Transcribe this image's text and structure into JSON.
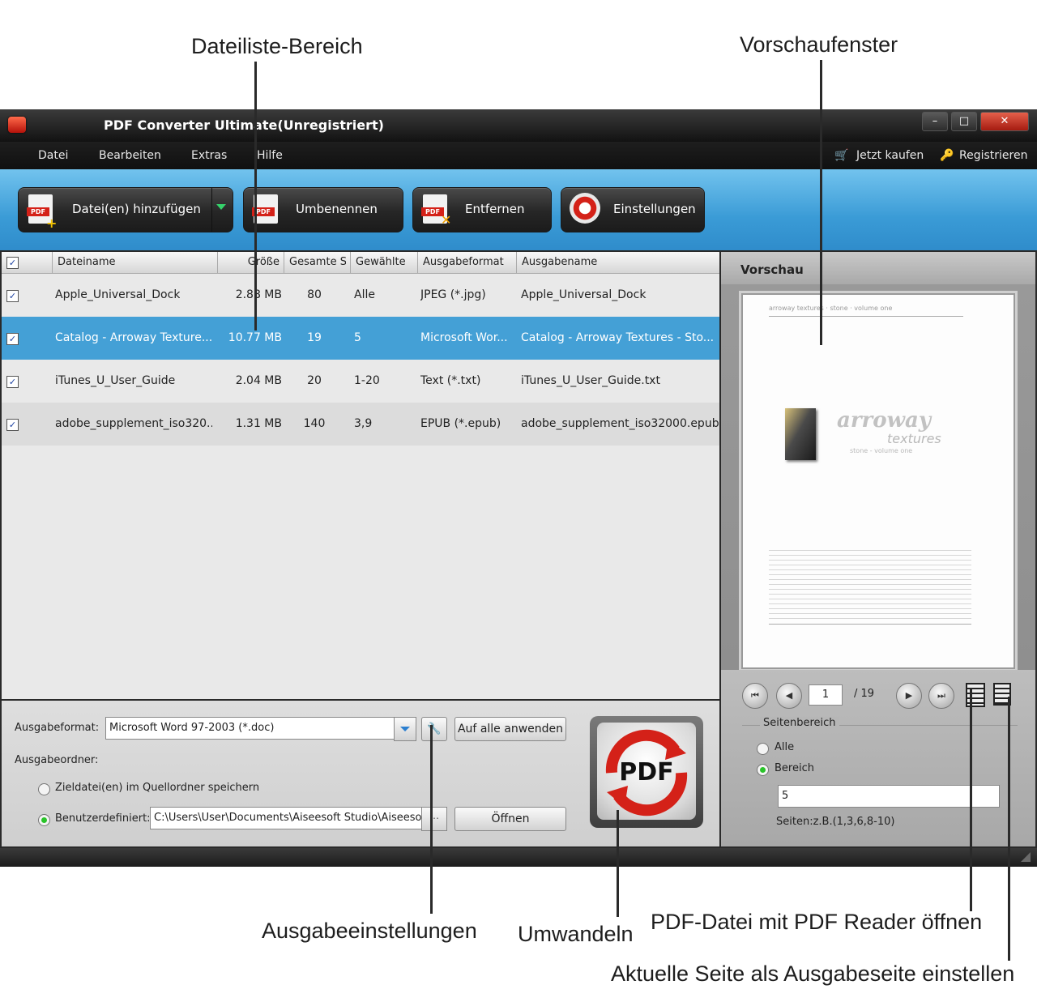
{
  "callouts": {
    "file_list_area": "Dateiliste-Bereich",
    "preview_window": "Vorschaufenster",
    "output_settings": "Ausgabeeinstellungen",
    "convert": "Umwandeln",
    "open_pdf_reader": "PDF-Datei mit PDF Reader öffnen",
    "set_current_page": "Aktuelle Seite als Ausgabeseite einstellen"
  },
  "window": {
    "title": "PDF Converter Ultimate(Unregistriert)"
  },
  "menu": {
    "items": [
      "Datei",
      "Bearbeiten",
      "Extras",
      "Hilfe"
    ],
    "buy": "Jetzt kaufen",
    "register": "Registrieren"
  },
  "toolbar": {
    "add": "Datei(en) hinzufügen",
    "rename": "Umbenennen",
    "remove": "Entfernen",
    "settings": "Einstellungen"
  },
  "table": {
    "headers": [
      "Dateiname",
      "Größe",
      "Gesamte S",
      "Gewählte",
      "Ausgabeformat",
      "Ausgabename"
    ],
    "rows": [
      {
        "name": "Apple_Universal_Dock",
        "size": "2.88 MB",
        "total": "80",
        "selected": "Alle",
        "format": "JPEG (*.jpg)",
        "output": "Apple_Universal_Dock"
      },
      {
        "name": "Catalog - Arroway Texture...",
        "size": "10.77 MB",
        "total": "19",
        "selected": "5",
        "format": "Microsoft Wor...",
        "output": "Catalog - Arroway Textures - Sto..."
      },
      {
        "name": "iTunes_U_User_Guide",
        "size": "2.04 MB",
        "total": "20",
        "selected": "1-20",
        "format": "Text (*.txt)",
        "output": "iTunes_U_User_Guide.txt"
      },
      {
        "name": "adobe_supplement_iso320...",
        "size": "1.31 MB",
        "total": "140",
        "selected": "3,9",
        "format": "EPUB (*.epub)",
        "output": "adobe_supplement_iso32000.epub"
      }
    ]
  },
  "bottom": {
    "format_label": "Ausgabeformat:",
    "format_value": "Microsoft Word 97-2003 (*.doc)",
    "apply_all": "Auf alle anwenden",
    "folder_label": "Ausgabeordner:",
    "save_source": "Zieldatei(en) im Quellordner speichern",
    "custom_label": "Benutzerdefiniert:",
    "custom_path": "C:\\Users\\User\\Documents\\Aiseesoft Studio\\Aiseeso",
    "open": "Öffnen",
    "convert_icon_text": "PDF"
  },
  "preview": {
    "title": "Vorschau",
    "doc_header": "arroway textures · stone · volume one",
    "doc_logo": "arroway",
    "doc_logo_sub": "textures",
    "doc_logo_sub2": "stone - volume one",
    "page_current": "1",
    "page_total": "/ 19",
    "range_label": "Seitenbereich",
    "all": "Alle",
    "range": "Bereich",
    "range_value": "5",
    "pages_hint": "Seiten:z.B.(1,3,6,8-10)"
  },
  "colors": {
    "toolbar_blue": "#3a9bd6",
    "selection_blue": "#44a0d6",
    "brand_red": "#d42118"
  }
}
